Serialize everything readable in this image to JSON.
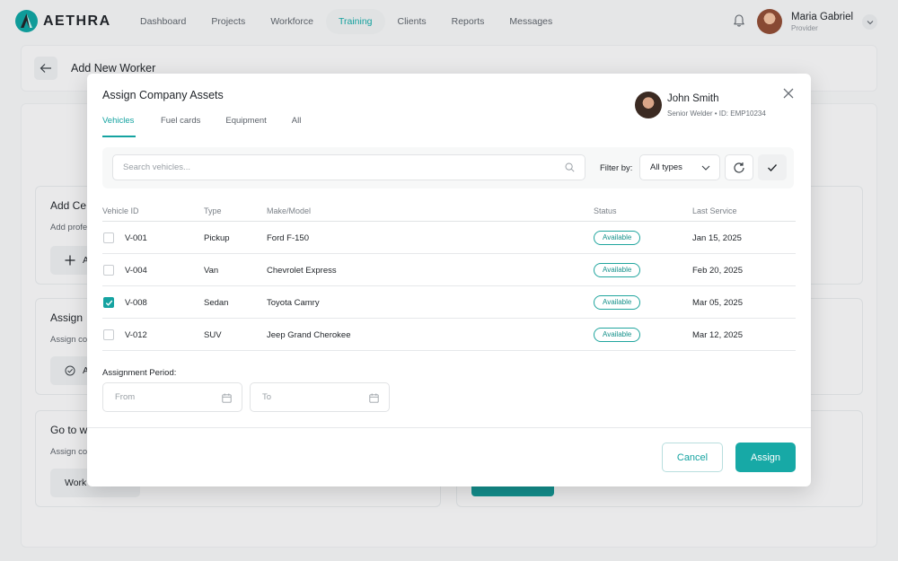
{
  "brand": {
    "name": "AETHRA",
    "accent": "#15a3a1"
  },
  "nav": {
    "items": [
      {
        "label": "Dashboard"
      },
      {
        "label": "Projects"
      },
      {
        "label": "Workforce"
      },
      {
        "label": "Training",
        "active": true
      },
      {
        "label": "Clients"
      },
      {
        "label": "Reports"
      },
      {
        "label": "Messages"
      }
    ]
  },
  "user": {
    "name": "Maria Gabriel",
    "role": "Provider"
  },
  "page": {
    "title": "Add New Worker",
    "sections": [
      {
        "title": "Add Ce",
        "subtitle": "Add profe",
        "button": "A"
      },
      {
        "title": "Assign",
        "subtitle": "Assign co",
        "button": "A"
      },
      {
        "title": "Go to w",
        "subtitle": "Assign co",
        "button": "Work"
      }
    ]
  },
  "modal": {
    "title": "Assign Company Assets",
    "worker": {
      "name": "John Smith",
      "meta": "Senior Welder • ID: EMP10234"
    },
    "tabs": [
      {
        "label": "Vehicles",
        "active": true
      },
      {
        "label": "Fuel cards"
      },
      {
        "label": "Equipment"
      },
      {
        "label": "All"
      }
    ],
    "search": {
      "placeholder": "Search vehicles...",
      "value": ""
    },
    "filter": {
      "label": "Filter by:",
      "selected": "All types"
    },
    "table": {
      "columns": [
        "Vehicle ID",
        "Type",
        "Make/Model",
        "Status",
        "Last Service"
      ],
      "rows": [
        {
          "checked": false,
          "id": "V-001",
          "type": "Pickup",
          "model": "Ford F-150",
          "status": "Available",
          "last_service": "Jan 15, 2025"
        },
        {
          "checked": false,
          "id": "V-004",
          "type": "Van",
          "model": "Chevrolet Express",
          "status": "Available",
          "last_service": "Feb 20, 2025"
        },
        {
          "checked": true,
          "id": "V-008",
          "type": "Sedan",
          "model": "Toyota Camry",
          "status": "Available",
          "last_service": "Mar 05, 2025"
        },
        {
          "checked": false,
          "id": "V-012",
          "type": "SUV",
          "model": "Jeep Grand Cherokee",
          "status": "Available",
          "last_service": "Mar 12, 2025"
        }
      ]
    },
    "period": {
      "label": "Assignment Period:",
      "from_placeholder": "From",
      "to_placeholder": "To"
    },
    "actions": {
      "cancel": "Cancel",
      "assign": "Assign"
    }
  }
}
